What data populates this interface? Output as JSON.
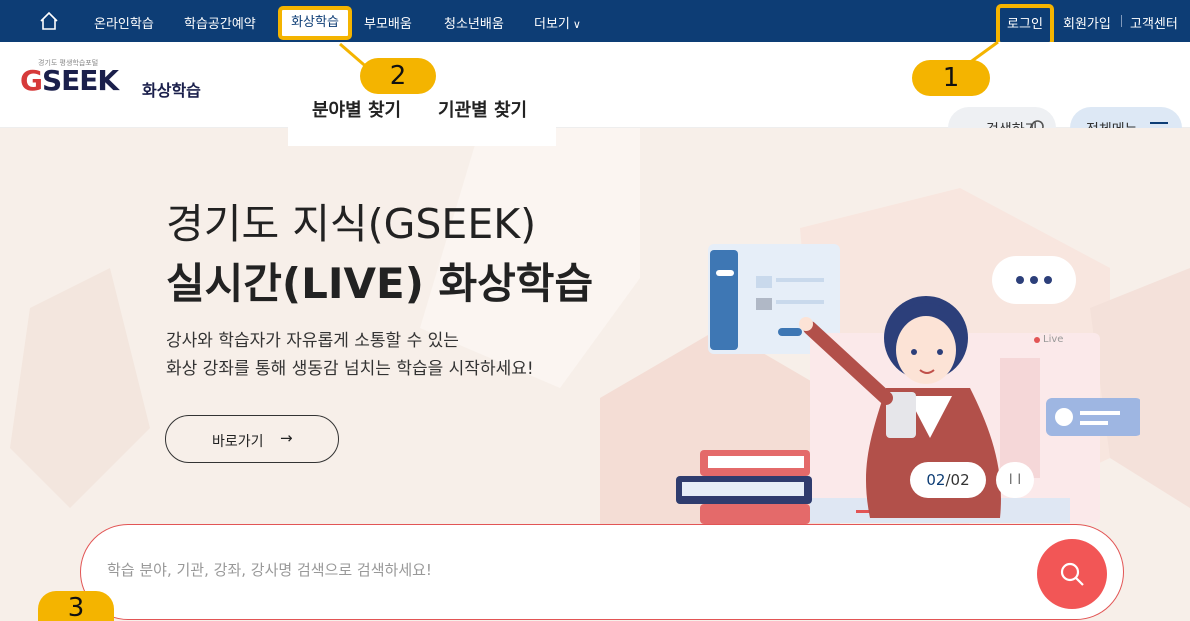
{
  "topnav": {
    "items": [
      "온라인학습",
      "학습공간예약",
      "화상학습",
      "부모배움",
      "청소년배움",
      "더보기"
    ],
    "more_chevron": "∨",
    "login": "로그인",
    "signup": "회원가입",
    "support": "고객센터"
  },
  "header": {
    "logo_small": "경기도 평생학습포털",
    "logo_text": "SEEK",
    "logo_g": "G",
    "logo_sub": "화상학습",
    "search_label": "검색하기",
    "menu_label": "전체메뉴"
  },
  "submenu": {
    "items": [
      "분야별 찾기",
      "기관별 찾기"
    ]
  },
  "hero": {
    "title_line1": "경기도 지식(GSEEK)",
    "title_line2": "실시간(LIVE) 화상학습",
    "desc_line1": "강사와 학습자가 자유롭게 소통할 수 있는",
    "desc_line2": "화상 강좌를 통해 생동감 넘치는 학습을 시작하세요!",
    "go_button": "바로가기",
    "go_arrow": "→",
    "live_label": "Live",
    "pager_current": "02",
    "pager_total": "/02",
    "pause": "I I"
  },
  "search": {
    "placeholder": "학습 분야, 기관, 강좌, 강사명 검색으로 검색하세요!"
  },
  "callouts": [
    "1",
    "2",
    "3"
  ],
  "colors": {
    "nav_bg": "#0d3d75",
    "highlight": "#f4b400",
    "accent_red": "#f25656",
    "hero_bg": "#f7efe9"
  }
}
